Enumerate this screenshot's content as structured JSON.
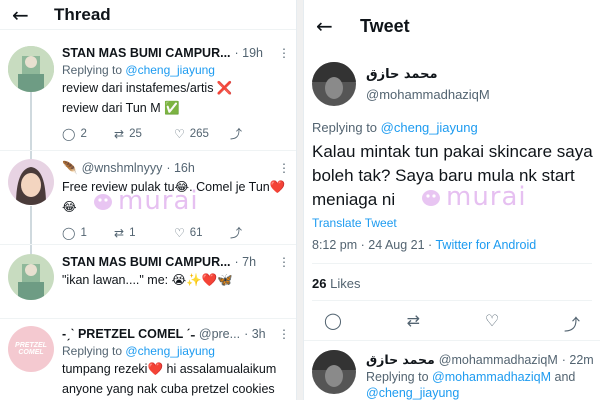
{
  "left": {
    "back_icon": "arrow-left-icon",
    "title": "Thread",
    "tweets": [
      {
        "name": "STAN MAS BUMI CAMPUR...",
        "handle": "",
        "time": "· 19h",
        "replying_prefix": "Replying to",
        "replying_to": "@cheng_jiayung",
        "lines": [
          "review dari instafemes/artis ❌",
          "review dari Tun M ✅"
        ],
        "replies": "2",
        "retweets": "25",
        "likes": "265"
      },
      {
        "name": "🪶",
        "handle": "@wnshmlnyyy",
        "time": "· 16h",
        "lines": [
          "Free review pulak tu😂. Comel je Tun❤️",
          "😂"
        ],
        "replies": "1",
        "retweets": "1",
        "likes": "61"
      },
      {
        "name": "STAN MAS BUMI CAMPUR...",
        "handle": "",
        "time": "· 7h",
        "lines": [
          "\"ikan lawan....\" me: 😭✨❤️🦋"
        ]
      },
      {
        "name": "-ˏˋ PRETZEL COMEL ˊ˗",
        "handle": "@pre...",
        "time": "· 3h",
        "replying_prefix": "Replying to",
        "replying_to": "@cheng_jiayung",
        "lines": [
          "tumpang rezeki❤️ hi assalamualaikum",
          "anyone yang nak cuba pretzel cookies"
        ],
        "avatar_text_1": "PRETZEL",
        "avatar_text_2": "COMEL"
      }
    ]
  },
  "right": {
    "back_icon": "arrow-left-icon",
    "title": "Tweet",
    "author_name": "محمد حازق",
    "author_handle": "@mohammadhaziqM",
    "replying_prefix": "Replying to",
    "replying_to": "@cheng_jiayung",
    "text": "Kalau mintak tun pakai skincare saya boleh tak? Saya baru mula nk start meniaga ni",
    "translate": "Translate Tweet",
    "time": "8:12 pm · 24 Aug 21 · ",
    "source": "Twitter for Android",
    "likes_count": "26",
    "likes_label": "Likes",
    "reply2": {
      "name": "محمد حازق",
      "handle": "@mohammadhaziqM",
      "time": "· 22m",
      "replying_prefix": "Replying to",
      "replying_to_1": "@mohammadhaziqM",
      "and": "and",
      "replying_to_2": "@cheng_jiayung"
    }
  },
  "watermark": "murai",
  "colors": {
    "accent": "#1d9bf0",
    "secondary_text": "#536471",
    "heart": "#e0245e",
    "watermark": "#d28ce6"
  }
}
